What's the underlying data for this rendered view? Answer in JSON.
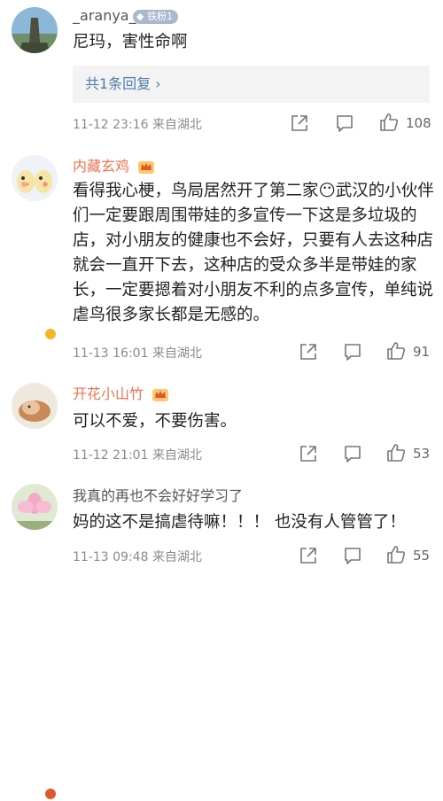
{
  "comments": [
    {
      "username": "_aranya_",
      "badge": "铁粉1",
      "text": "尼玛，害性命啊",
      "reply_link": "共1条回复",
      "time": "11-12 23:16",
      "location": "来自湖北",
      "likes": "108"
    },
    {
      "username": "内藏玄鸡",
      "text": "看得我心梗，鸟局居然开了第二家😶武汉的小伙伴们一定要跟周围带娃的多宣传一下这是多垃圾的店，对小朋友的健康也不会好，只要有人去这种店就会一直开下去，这种店的受众多半是带娃的家长，一定要摁着对小朋友不利的点多宣传，单纯说虐鸟很多家长都是无感的。",
      "time": "11-13 16:01",
      "location": "来自湖北",
      "likes": "91"
    },
    {
      "username": "开花小山竹",
      "text": "可以不爱，不要伤害。",
      "time": "11-12 21:01",
      "location": "来自湖北",
      "likes": "53"
    },
    {
      "username": "我真的再也不会好好学习了",
      "text": "妈的这不是搞虐待嘛！！！ 也没有人管管了！",
      "time": "11-13 09:48",
      "location": "来自湖北",
      "likes": "55"
    }
  ],
  "colors": {
    "username_orange": "#eb7350",
    "link_blue": "#507daf",
    "meta_gray": "#8a8a8a",
    "reply_bg": "#f3f3f3"
  },
  "icons": [
    "share-icon",
    "comment-icon",
    "like-icon",
    "crown-icon",
    "diamond-icon"
  ]
}
